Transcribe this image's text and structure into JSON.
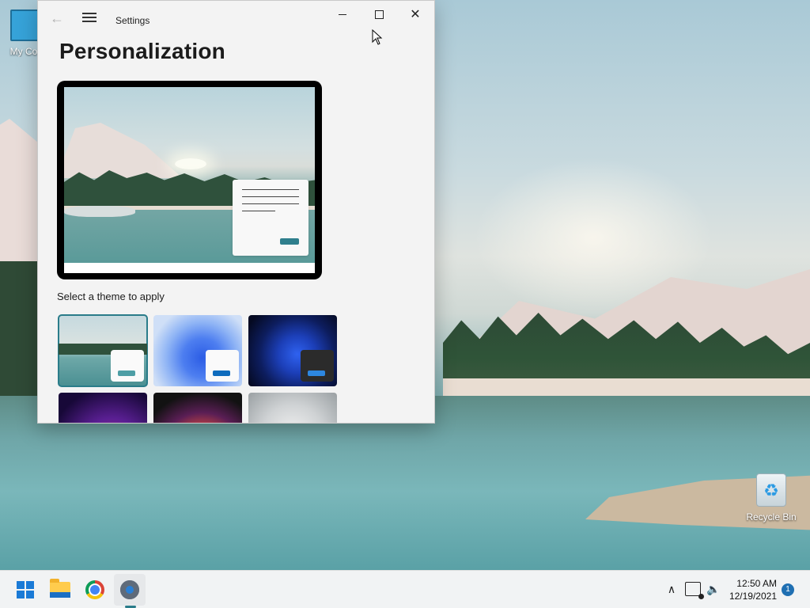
{
  "desktop": {
    "icons": {
      "my_computer": "My Com",
      "recycle_bin": "Recycle Bin"
    }
  },
  "window": {
    "title": "Settings",
    "page_title": "Personalization",
    "section_label": "Select a theme to apply",
    "themes": [
      {
        "name": "lake-theme",
        "selected": true
      },
      {
        "name": "windows-light-theme",
        "selected": false
      },
      {
        "name": "windows-dark-theme",
        "selected": false
      },
      {
        "name": "glow-theme",
        "selected": false
      },
      {
        "name": "captured-motion-theme",
        "selected": false
      },
      {
        "name": "flow-theme",
        "selected": false
      }
    ],
    "accent_color": "#2a7c8a"
  },
  "taskbar": {
    "apps": [
      "start",
      "file-explorer",
      "google-chrome",
      "settings"
    ],
    "clock_time": "12:50 AM",
    "clock_date": "12/19/2021",
    "notification_count": "1"
  }
}
